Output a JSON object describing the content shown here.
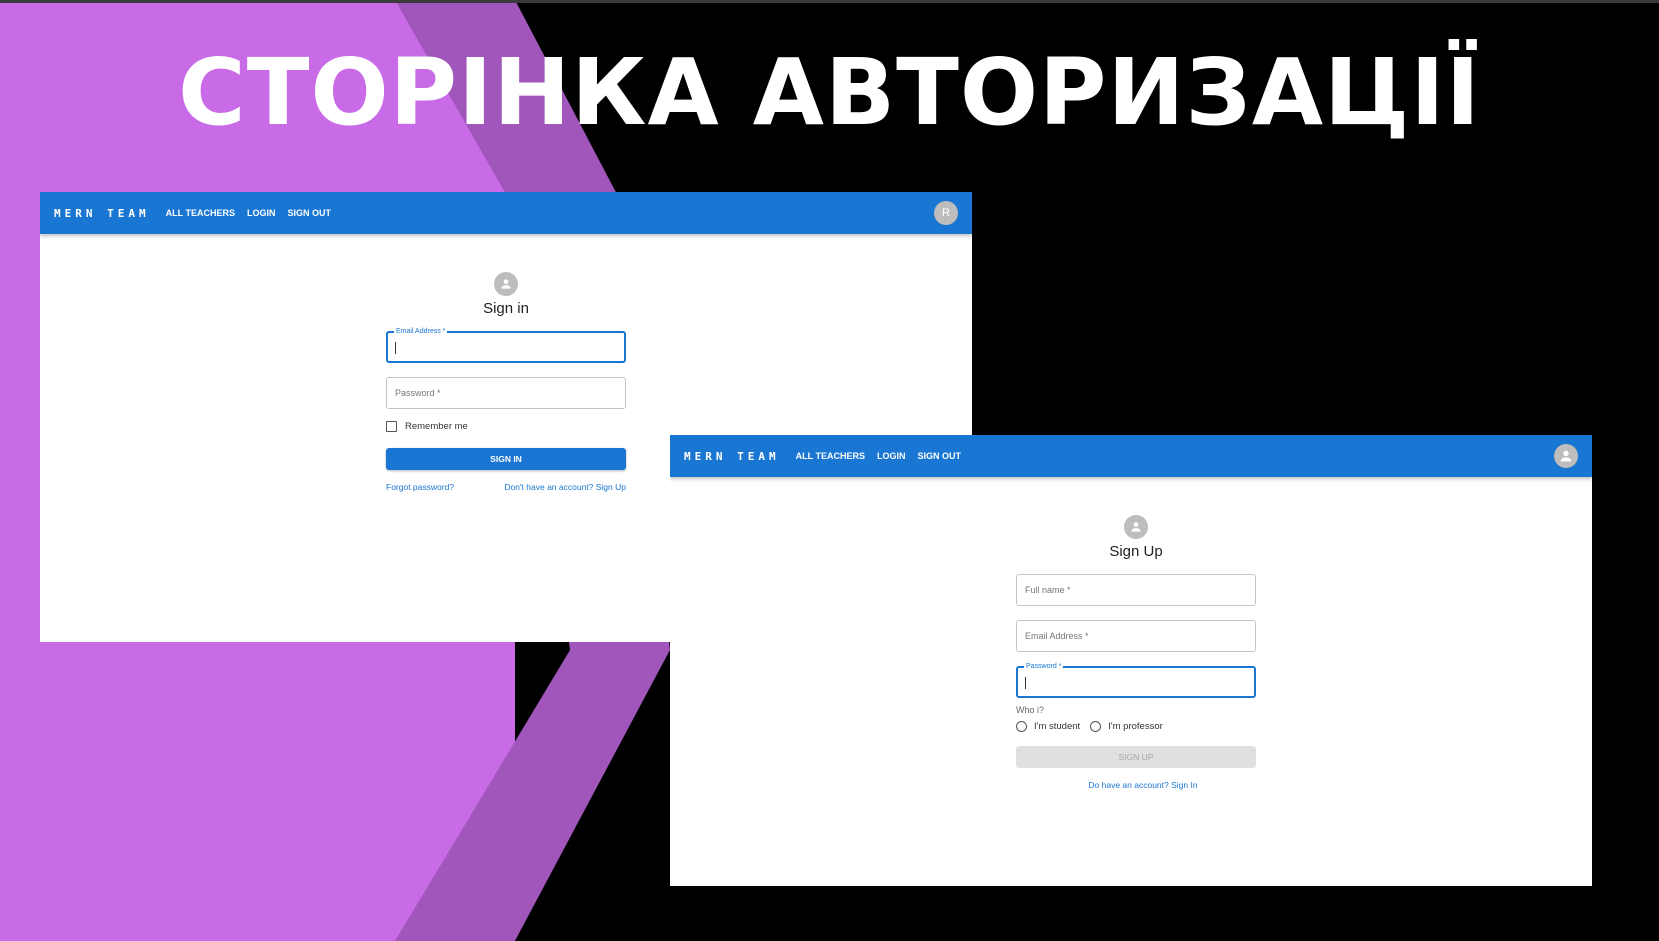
{
  "slide": {
    "title": "СТОРІНКА АВТОРИЗАЦІЇ"
  },
  "colors": {
    "accent": "#1976d2",
    "purple_light": "#c96ae6",
    "purple_dark": "#a056bb",
    "background": "#000000"
  },
  "signin_window": {
    "navbar": {
      "brand": "MERN TEAM",
      "links": [
        "ALL TEACHERS",
        "LOGIN",
        "SIGN OUT"
      ],
      "avatar_letter": "R"
    },
    "form": {
      "icon": "person-icon",
      "title": "Sign in",
      "email_label": "Email Address *",
      "password_placeholder": "Password *",
      "remember_label": "Remember me",
      "submit_label": "SIGN IN",
      "forgot_link": "Forgot password?",
      "signup_link": "Don't have an account? Sign Up"
    }
  },
  "signup_window": {
    "navbar": {
      "brand": "MERN TEAM",
      "links": [
        "ALL TEACHERS",
        "LOGIN",
        "SIGN OUT"
      ],
      "avatar_icon": "person-icon"
    },
    "form": {
      "icon": "person-icon",
      "title": "Sign Up",
      "fullname_placeholder": "Full name *",
      "email_placeholder": "Email Address *",
      "password_label": "Password *",
      "who_label": "Who i?",
      "radio_student": "I'm student",
      "radio_professor": "I'm professor",
      "submit_label": "SIGN UP",
      "signin_link": "Do have an account? Sign In"
    }
  }
}
